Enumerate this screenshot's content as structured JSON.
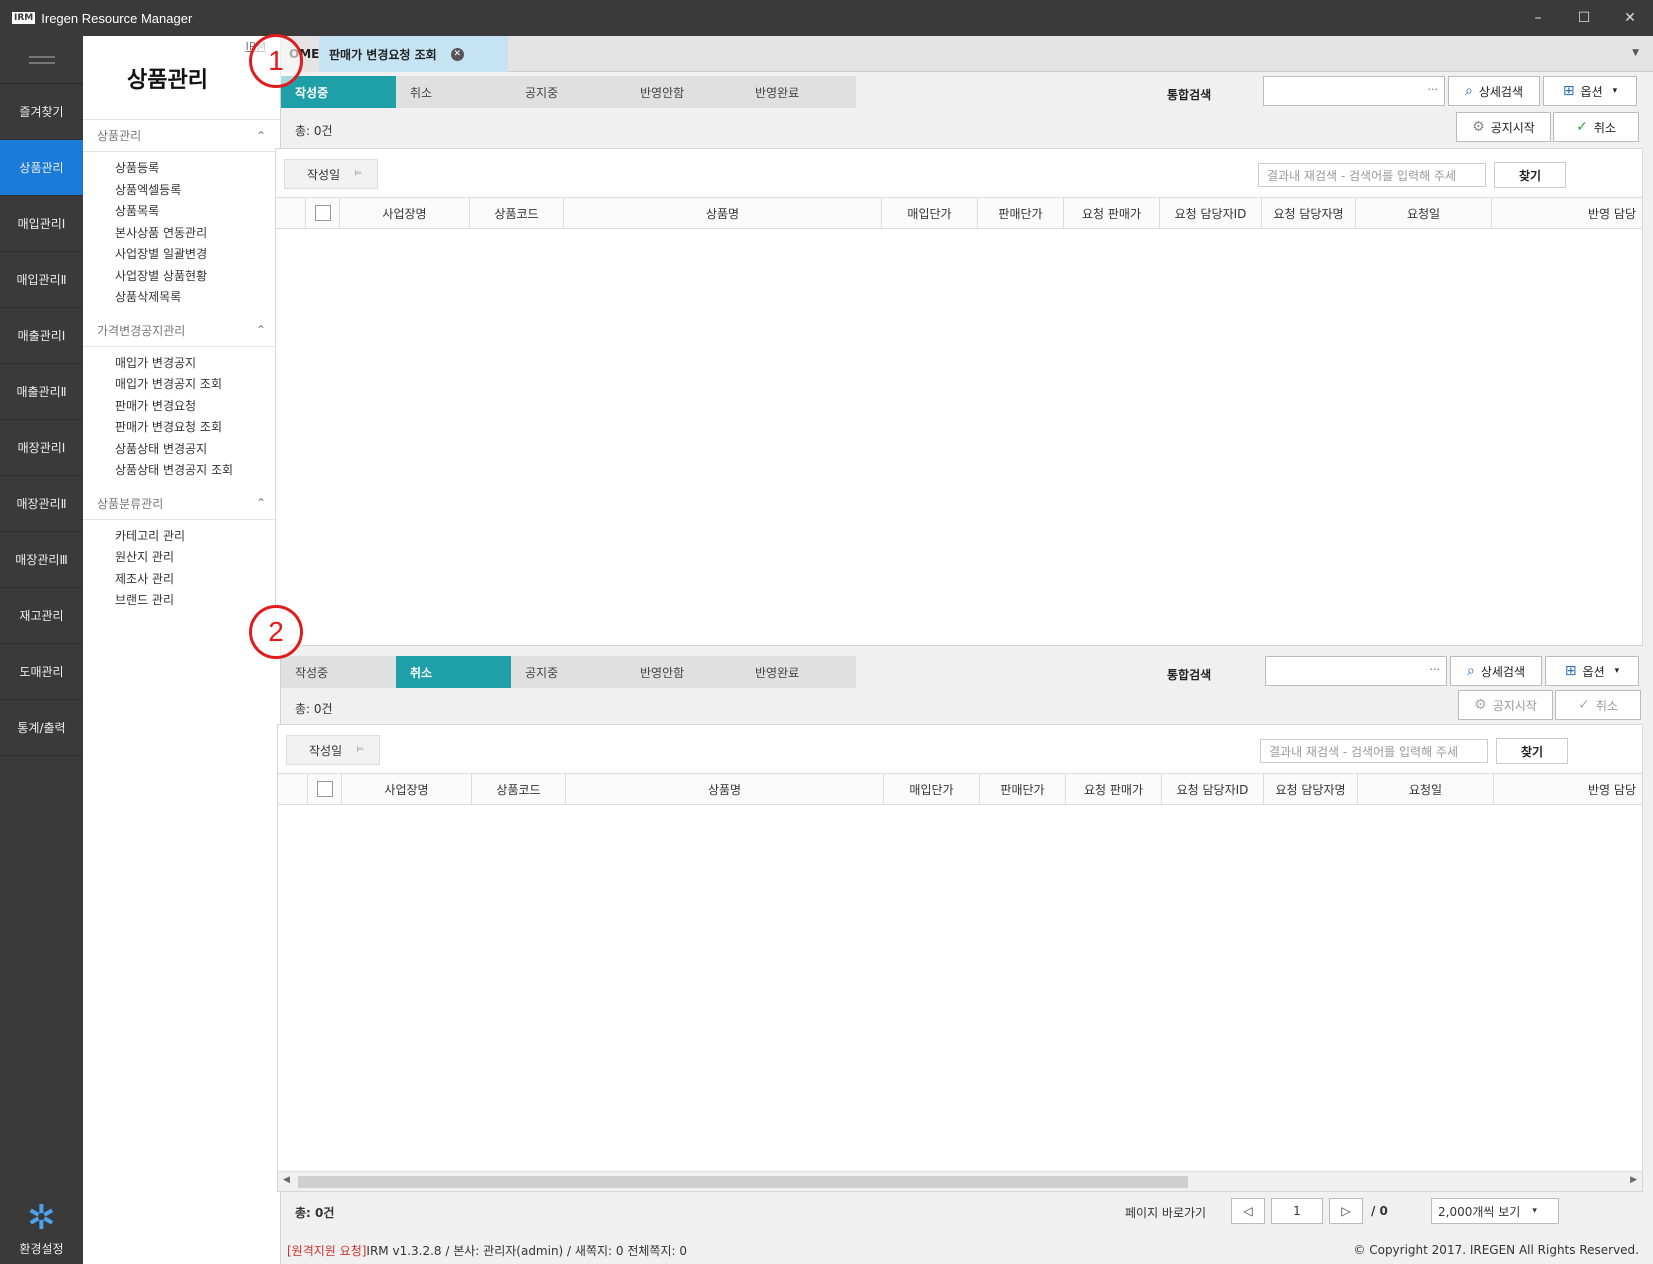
{
  "window": {
    "logo": "IRM",
    "title": "Iregen Resource Manager",
    "minimize": "–",
    "maximize": "☐",
    "close": "✕"
  },
  "rail": {
    "items": [
      {
        "label": "즐겨찾기",
        "active": false
      },
      {
        "label": "상품관리",
        "active": true
      },
      {
        "label": "매입관리Ⅰ",
        "active": false
      },
      {
        "label": "매입관리Ⅱ",
        "active": false
      },
      {
        "label": "매출관리Ⅰ",
        "active": false
      },
      {
        "label": "매출관리Ⅱ",
        "active": false
      },
      {
        "label": "매장관리Ⅰ",
        "active": false
      },
      {
        "label": "매장관리Ⅱ",
        "active": false
      },
      {
        "label": "매장관리Ⅲ",
        "active": false
      },
      {
        "label": "재고관리",
        "active": false
      },
      {
        "label": "도매관리",
        "active": false
      },
      {
        "label": "통계/출력",
        "active": false
      }
    ],
    "settings_label": "환경설정"
  },
  "menu": {
    "title": "상품관리",
    "irm_link": "IRM",
    "sections": [
      {
        "label": "상품관리",
        "items": [
          "상품등록",
          "상품엑셀등록",
          "상품목록",
          "본사상품 연동관리",
          "사업장별 일괄변경",
          "사업장별 상품현황",
          "상품삭제목록"
        ]
      },
      {
        "label": "가격변경공지관리",
        "items": [
          "매입가 변경공지",
          "매입가 변경공지 조회",
          "판매가 변경요청",
          "판매가 변경요청 조회",
          "상품상태 변경공지",
          "상품상태 변경공지 조회"
        ]
      },
      {
        "label": "상품분류관리",
        "items": [
          "카테고리 관리",
          "원산지 관리",
          "제조사 관리",
          "브랜드 관리"
        ]
      }
    ]
  },
  "tabs": {
    "home": "OME",
    "current": "판매가 변경요청 조회"
  },
  "status_tabs": [
    "작성중",
    "취소",
    "공지중",
    "반영안함",
    "반영완료"
  ],
  "search": {
    "label": "통합검색",
    "value": "",
    "dots": "···",
    "detail_button": "상세검색",
    "options_button": "옵션"
  },
  "actions": {
    "start_notice": "공지시작",
    "cancel": "취소"
  },
  "total": "총: 0건",
  "filter": {
    "date_label": "작성일"
  },
  "refilter": {
    "placeholder": "결과내 재검색 - 검색어를 입력해 주세",
    "find_button": "찾기"
  },
  "columns": [
    "사업장명",
    "상품코드",
    "상품명",
    "매입단가",
    "판매단가",
    "요청 판매가",
    "요청 담당자ID",
    "요청 담당자명",
    "요청일",
    "반영 담당"
  ],
  "pager": {
    "total": "총: 0건",
    "goto_label": "페이지 바로가기",
    "page": "1",
    "of": "/ 0",
    "per_page": "2,000개씩 보기"
  },
  "footer": {
    "remote": "[원격지원 요청]",
    "info": " IRM v1.3.2.8 /  본사: 관리자(admin)  / 새쪽지: 0  전체쪽지: 0",
    "copyright": "© Copyright 2017. IREGEN All Rights Reserved."
  },
  "markers": [
    "1",
    "2"
  ],
  "colors": {
    "accent_teal": "#1fa0a8",
    "rail_active": "#1a7bd8",
    "tab_active": "#c6e3f3",
    "marker": "#e01b1b"
  }
}
